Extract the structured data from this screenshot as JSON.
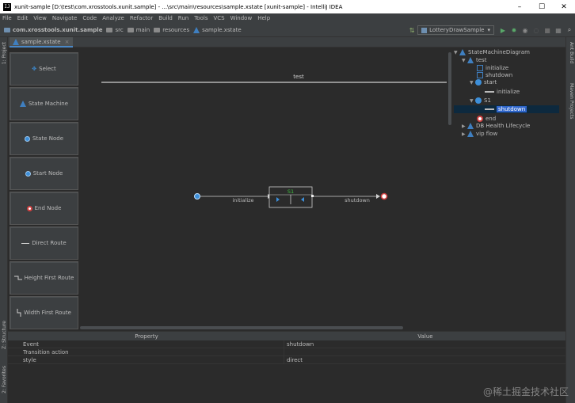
{
  "window": {
    "title": "xunit-sample [D:\\test\\com.xrosstools.xunit.sample] - ...\\src\\main\\resources\\sample.xstate [xunit-sample] - IntelliJ IDEA",
    "app_icon": "IJ",
    "minimize": "–",
    "maximize": "☐",
    "close": "✕"
  },
  "menu": [
    "File",
    "Edit",
    "View",
    "Navigate",
    "Code",
    "Analyze",
    "Refactor",
    "Build",
    "Run",
    "Tools",
    "VCS",
    "Window",
    "Help"
  ],
  "breadcrumb": {
    "project": "com.xrosstools.xunit.sample",
    "src": "src",
    "main": "main",
    "resources": "resources",
    "file": "sample.xstate"
  },
  "run_config": {
    "label": "LotteryDrawSample",
    "dropdown_glyph": "▾"
  },
  "left_tools": {
    "project": "1: Project",
    "structure": "Z: Structure",
    "favorites": "2: Favorites"
  },
  "right_tools": {
    "ant": "Ant Build",
    "maven": "Maven Projects"
  },
  "editor_tab": {
    "label": "sample.xstate",
    "close": "×"
  },
  "palette": [
    {
      "label": "Select",
      "icon": "select-icon"
    },
    {
      "label": "State Machine",
      "icon": "state-machine-icon"
    },
    {
      "label": "State Node",
      "icon": "state-node-icon"
    },
    {
      "label": "Start Node",
      "icon": "start-node-icon"
    },
    {
      "label": "End Node",
      "icon": "end-node-icon"
    },
    {
      "label": "Direct Route",
      "icon": "direct-route-icon"
    },
    {
      "label": "Height First Route",
      "icon": "height-first-route-icon"
    },
    {
      "label": "Width First Route",
      "icon": "width-first-route-icon"
    }
  ],
  "diagram": {
    "machine_name": "test",
    "state_name": "S1",
    "transition_in": "initialize",
    "transition_out": "shutdown"
  },
  "tree": {
    "root": "StateMachineDiagram",
    "machine": "test",
    "events": [
      "initialize",
      "shutdown"
    ],
    "start": "start",
    "start_transition": "initialize",
    "state": "S1",
    "state_transition": "shutdown",
    "end": "end",
    "others": [
      "DB Health Lifecycle",
      "vip flow"
    ]
  },
  "properties": {
    "col_property": "Property",
    "col_value": "Value",
    "rows": [
      {
        "name": "Event",
        "value": "shutdown"
      },
      {
        "name": "Transition action",
        "value": ""
      },
      {
        "name": "style",
        "value": "direct"
      }
    ]
  },
  "watermark": "@稀土掘金技术社区",
  "colors": {
    "accent_blue": "#3d8fd9",
    "selection": "#2f65ca",
    "end_red": "#d04040",
    "state_green": "#3fbf3f"
  }
}
